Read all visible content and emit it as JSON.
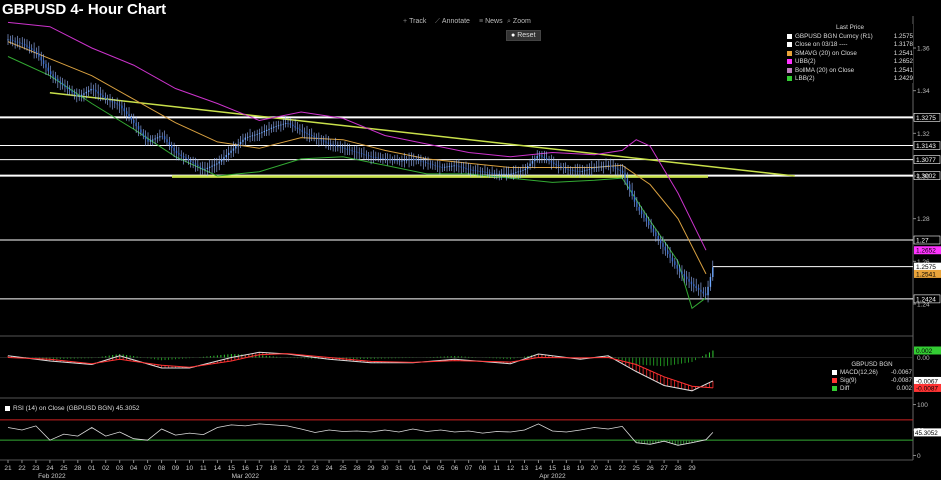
{
  "title": "GBPUSD 4- Hour Chart",
  "toolbar": {
    "items": [
      {
        "icon": "crosshair-icon",
        "glyph": "+",
        "label": "Track"
      },
      {
        "icon": "pencil-icon",
        "glyph": "⟋",
        "label": "Annotate"
      },
      {
        "icon": "news-icon",
        "glyph": "≡",
        "label": "News"
      },
      {
        "icon": "zoom-icon",
        "glyph": "⌕",
        "label": "Zoom"
      }
    ],
    "reset_label": "Reset",
    "reset_glyph": "●"
  },
  "legend": {
    "header": "Last Price",
    "items": [
      {
        "name": "GBPUSD BGN Curncy  (R1)",
        "value": "1.2575",
        "color": "#ffffff"
      },
      {
        "name": "Close on 03/18 ----",
        "value": "1.3178",
        "color": "#ffffff"
      },
      {
        "name": "SMAVG (20)  on Close",
        "value": "1.2541",
        "color": "#e8a33a"
      },
      {
        "name": "UBB(2)",
        "value": "1.2652",
        "color": "#ff33ff"
      },
      {
        "name": "BollMA (20)  on Close",
        "value": "1.2541",
        "color": "#c080c0"
      },
      {
        "name": "LBB(2)",
        "value": "1.2429",
        "color": "#33cc33"
      }
    ]
  },
  "macd_legend": {
    "header": "GBPUSD BGN",
    "items": [
      {
        "name": "MACD(12,26)",
        "value": "-0.0067",
        "color": "#ffffff"
      },
      {
        "name": "Sig(9)",
        "value": "-0.0087",
        "color": "#ff3333"
      },
      {
        "name": "Diff",
        "value": "0.002",
        "color": "#33cc33"
      }
    ]
  },
  "rsi_legend": {
    "label": "RSI (14)  on Close (GBPUSD BGN) 45.3052"
  },
  "chart_data": {
    "type": "line",
    "title": "GBPUSD 4- Hour Chart",
    "price_axis": {
      "ylim": [
        1.225,
        1.375
      ],
      "ticks": [
        "1.36",
        "1.34",
        "1.32",
        "1.30",
        "1.28",
        "1.26",
        "1.24"
      ]
    },
    "horizontal_levels": [
      {
        "label": "1.3275",
        "value": 1.3275
      },
      {
        "label": "1.3143",
        "value": 1.3143
      },
      {
        "label": "1.3077",
        "value": 1.3077
      },
      {
        "label": "1.3002",
        "value": 1.3002
      },
      {
        "label": "1.27",
        "value": 1.27
      },
      {
        "label": "1.2424",
        "value": 1.2424
      }
    ],
    "price_badges": [
      {
        "label": "1.2652",
        "value": 1.2652,
        "color": "#ff33ff"
      },
      {
        "label": "1.2575",
        "value": 1.2575,
        "color": "#ffffff"
      },
      {
        "label": "1.2541",
        "value": 1.2541,
        "color": "#e8a33a"
      }
    ],
    "trendline": {
      "from": [
        10.0,
        1.339
      ],
      "to": [
        61.5,
        1.3
      ]
    },
    "x_ticks": [
      "21",
      "22",
      "23",
      "24",
      "25",
      "28",
      "01",
      "02",
      "03",
      "04",
      "07",
      "08",
      "09",
      "10",
      "11",
      "14",
      "15",
      "16",
      "17",
      "18",
      "21",
      "22",
      "23",
      "24",
      "25",
      "28",
      "29",
      "30",
      "31",
      "01",
      "04",
      "05",
      "06",
      "07",
      "08",
      "11",
      "12",
      "13",
      "14",
      "15",
      "18",
      "19",
      "20",
      "21",
      "22",
      "25",
      "26",
      "27",
      "28",
      "29"
    ],
    "month_labels": [
      {
        "label": "Feb 2022",
        "at": 3
      },
      {
        "label": "Mar 2022",
        "at": 17
      },
      {
        "label": "Apr 2022",
        "at": 39
      }
    ],
    "price_path": [
      [
        0,
        1.364
      ],
      [
        1,
        1.362
      ],
      [
        2,
        1.358
      ],
      [
        3,
        1.348
      ],
      [
        4,
        1.342
      ],
      [
        5,
        1.337
      ],
      [
        6,
        1.341
      ],
      [
        7,
        1.336
      ],
      [
        8,
        1.333
      ],
      [
        9,
        1.325
      ],
      [
        10,
        1.316
      ],
      [
        11,
        1.319
      ],
      [
        12,
        1.311
      ],
      [
        13,
        1.307
      ],
      [
        14,
        1.303
      ],
      [
        15,
        1.306
      ],
      [
        16,
        1.312
      ],
      [
        17,
        1.318
      ],
      [
        18,
        1.32
      ],
      [
        19,
        1.323
      ],
      [
        20,
        1.325
      ],
      [
        21,
        1.321
      ],
      [
        22,
        1.318
      ],
      [
        23,
        1.315
      ],
      [
        24,
        1.313
      ],
      [
        25,
        1.311
      ],
      [
        26,
        1.309
      ],
      [
        27,
        1.308
      ],
      [
        28,
        1.307
      ],
      [
        29,
        1.308
      ],
      [
        30,
        1.306
      ],
      [
        31,
        1.304
      ],
      [
        32,
        1.305
      ],
      [
        33,
        1.303
      ],
      [
        34,
        1.302
      ],
      [
        35,
        1.301
      ],
      [
        36,
        1.301
      ],
      [
        37,
        1.303
      ],
      [
        38,
        1.31
      ],
      [
        39,
        1.306
      ],
      [
        40,
        1.303
      ],
      [
        41,
        1.302
      ],
      [
        42,
        1.304
      ],
      [
        43,
        1.305
      ],
      [
        44,
        1.302
      ],
      [
        45,
        1.286
      ],
      [
        46,
        1.276
      ],
      [
        47,
        1.266
      ],
      [
        48,
        1.256
      ],
      [
        49,
        1.249
      ],
      [
        50,
        1.244
      ],
      [
        50.5,
        1.2575
      ]
    ],
    "sma_path": [
      [
        0,
        1.363
      ],
      [
        3,
        1.355
      ],
      [
        6,
        1.347
      ],
      [
        9,
        1.336
      ],
      [
        12,
        1.325
      ],
      [
        15,
        1.316
      ],
      [
        18,
        1.313
      ],
      [
        21,
        1.318
      ],
      [
        24,
        1.317
      ],
      [
        27,
        1.312
      ],
      [
        30,
        1.308
      ],
      [
        33,
        1.306
      ],
      [
        36,
        1.304
      ],
      [
        39,
        1.304
      ],
      [
        42,
        1.304
      ],
      [
        44,
        1.305
      ],
      [
        46,
        1.296
      ],
      [
        48,
        1.28
      ],
      [
        50,
        1.2541
      ]
    ],
    "ubb_path": [
      [
        0,
        1.372
      ],
      [
        3,
        1.37
      ],
      [
        6,
        1.36
      ],
      [
        9,
        1.352
      ],
      [
        12,
        1.341
      ],
      [
        15,
        1.334
      ],
      [
        18,
        1.326
      ],
      [
        21,
        1.33
      ],
      [
        24,
        1.327
      ],
      [
        27,
        1.319
      ],
      [
        30,
        1.315
      ],
      [
        33,
        1.311
      ],
      [
        36,
        1.309
      ],
      [
        39,
        1.311
      ],
      [
        42,
        1.31
      ],
      [
        44,
        1.312
      ],
      [
        45,
        1.317
      ],
      [
        46,
        1.314
      ],
      [
        48,
        1.292
      ],
      [
        50,
        1.2652
      ]
    ],
    "lbb_path": [
      [
        0,
        1.356
      ],
      [
        3,
        1.347
      ],
      [
        6,
        1.334
      ],
      [
        9,
        1.322
      ],
      [
        12,
        1.309
      ],
      [
        15,
        1.3
      ],
      [
        18,
        1.302
      ],
      [
        21,
        1.308
      ],
      [
        24,
        1.309
      ],
      [
        27,
        1.305
      ],
      [
        30,
        1.301
      ],
      [
        33,
        1.301
      ],
      [
        36,
        1.299
      ],
      [
        39,
        1.297
      ],
      [
        42,
        1.298
      ],
      [
        44,
        1.299
      ],
      [
        46,
        1.279
      ],
      [
        48,
        1.26
      ],
      [
        49,
        1.238
      ],
      [
        50,
        1.2429
      ]
    ],
    "macd": {
      "ylim": [
        -0.011,
        0.005
      ],
      "ticks": [
        "0.00"
      ],
      "badges": [
        {
          "label": "0.002",
          "value": 0.002,
          "color": "#33cc33"
        },
        {
          "label": "-0.0067",
          "value": -0.0067,
          "color": "#ffffff"
        },
        {
          "label": "-0.0087",
          "value": -0.0087,
          "color": "#ff3333"
        }
      ],
      "macd_path": [
        [
          0,
          0.0005
        ],
        [
          3,
          -0.001
        ],
        [
          6,
          -0.002
        ],
        [
          8,
          0.0005
        ],
        [
          11,
          -0.003
        ],
        [
          13,
          -0.003
        ],
        [
          16,
          0.0
        ],
        [
          18,
          0.0015
        ],
        [
          20,
          0.001
        ],
        [
          23,
          -0.0005
        ],
        [
          26,
          -0.0015
        ],
        [
          29,
          -0.0015
        ],
        [
          32,
          -0.0005
        ],
        [
          36,
          -0.0018
        ],
        [
          38,
          0.001
        ],
        [
          41,
          -0.0005
        ],
        [
          43,
          0.0005
        ],
        [
          45,
          -0.004
        ],
        [
          47,
          -0.008
        ],
        [
          49,
          -0.0095
        ],
        [
          50.5,
          -0.0067
        ]
      ],
      "signal_path": [
        [
          0,
          0.0
        ],
        [
          3,
          -0.0005
        ],
        [
          6,
          -0.0018
        ],
        [
          8,
          -0.0005
        ],
        [
          11,
          -0.0022
        ],
        [
          13,
          -0.0028
        ],
        [
          16,
          -0.001
        ],
        [
          18,
          0.0008
        ],
        [
          20,
          0.0011
        ],
        [
          23,
          0.0
        ],
        [
          26,
          -0.0011
        ],
        [
          29,
          -0.0014
        ],
        [
          32,
          -0.0009
        ],
        [
          36,
          -0.0013
        ],
        [
          38,
          0.0
        ],
        [
          41,
          -0.0001
        ],
        [
          43,
          0.0
        ],
        [
          45,
          -0.002
        ],
        [
          47,
          -0.0055
        ],
        [
          49,
          -0.0082
        ],
        [
          50.5,
          -0.0087
        ]
      ]
    },
    "rsi": {
      "ylim": [
        -5,
        105
      ],
      "ticks": [
        "100",
        "50",
        "0"
      ],
      "levels": [
        70,
        30
      ],
      "badge": {
        "label": "45.3052",
        "value": 45.3052
      },
      "path": [
        [
          0,
          55
        ],
        [
          1,
          50
        ],
        [
          2,
          58
        ],
        [
          3,
          30
        ],
        [
          4,
          42
        ],
        [
          5,
          38
        ],
        [
          6,
          55
        ],
        [
          7,
          38
        ],
        [
          8,
          46
        ],
        [
          9,
          33
        ],
        [
          10,
          30
        ],
        [
          11,
          52
        ],
        [
          12,
          40
        ],
        [
          13,
          44
        ],
        [
          14,
          41
        ],
        [
          15,
          55
        ],
        [
          16,
          60
        ],
        [
          17,
          58
        ],
        [
          18,
          62
        ],
        [
          19,
          60
        ],
        [
          20,
          58
        ],
        [
          21,
          52
        ],
        [
          22,
          45
        ],
        [
          23,
          50
        ],
        [
          24,
          47
        ],
        [
          25,
          48
        ],
        [
          26,
          46
        ],
        [
          27,
          50
        ],
        [
          28,
          46
        ],
        [
          29,
          52
        ],
        [
          30,
          47
        ],
        [
          31,
          50
        ],
        [
          32,
          46
        ],
        [
          33,
          48
        ],
        [
          34,
          44
        ],
        [
          35,
          47
        ],
        [
          36,
          46
        ],
        [
          37,
          50
        ],
        [
          38,
          62
        ],
        [
          39,
          48
        ],
        [
          40,
          46
        ],
        [
          41,
          50
        ],
        [
          42,
          55
        ],
        [
          43,
          52
        ],
        [
          44,
          57
        ],
        [
          45,
          25
        ],
        [
          46,
          22
        ],
        [
          47,
          28
        ],
        [
          48,
          20
        ],
        [
          49,
          25
        ],
        [
          50,
          31
        ],
        [
          50.5,
          45.3
        ]
      ]
    }
  }
}
